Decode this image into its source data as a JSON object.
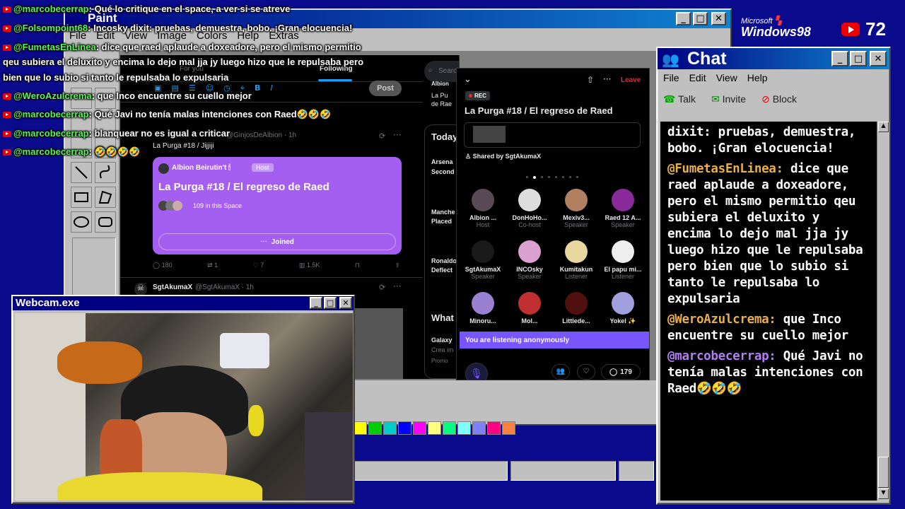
{
  "overlay_chat": [
    {
      "user": "@marcobecerrap",
      "text": ": Qué lo critique en el space, a ver si se atreve"
    },
    {
      "user": "@Folsompoint68",
      "text": ": Incosky dixit: pruebas, demuestra, bobo. ¡Gran elocuencia!"
    },
    {
      "user": "@FumetasEnLinea",
      "text": ": dice que raed aplaude a doxeadore, pero el mismo permitio"
    },
    {
      "user": "",
      "text": "qeu subiera el deluxito y encima lo dejo mal jja jy luego hizo que le repulsaba pero"
    },
    {
      "user": "",
      "text": "bien que lo subio si tanto le repulsaba lo expulsaria"
    },
    {
      "user": "@WeroAzulcrema",
      "text": ": que Inco encuentre su cuello mejor"
    },
    {
      "user": "@marcobecerrap",
      "text": ": Qué Javi no tenía malas intenciones con Raed🤣🤣🤣"
    },
    {
      "user": "@marcobecerrap",
      "text": ": blanquear no es igual a criticar"
    },
    {
      "user": "@marcobecerrap",
      "text": ": 🤣🤣🤣🤣"
    }
  ],
  "branding": {
    "microsoft": "Microsoft",
    "windows": "Windows98",
    "viewer_count": "72"
  },
  "paint": {
    "title": "Paint",
    "menu": [
      "File",
      "Edit",
      "View",
      "Image",
      "Colors",
      "Help",
      "Extras"
    ],
    "palette": [
      "#ffff00",
      "#00cc00",
      "#00cccc",
      "#0000ff",
      "#ff00ff",
      "#ffff80",
      "#00ff80",
      "#80ffff",
      "#8080ff",
      "#ff0080",
      "#ff8040"
    ]
  },
  "x_page": {
    "tabs": [
      "For you",
      "Following"
    ],
    "post_button": "Post",
    "tweet1": {
      "meta": "@GinjosDeAlbion · 1h",
      "text": "La Purga #18 / Jijjiji"
    },
    "space_card": {
      "host": "Albion Beirutin't 🕯",
      "host_badge": "Host",
      "title": "La Purga #18 / El regreso de Raed",
      "listeners": "109 in this Space",
      "joined": "Joined"
    },
    "tweet_stats": {
      "replies": "180",
      "retweets": "1",
      "likes": "7",
      "views": "1.5K"
    },
    "tweet2": {
      "name": "SgtAkumaX",
      "handle": "@SgtAkumaX · 1h"
    },
    "right": {
      "search": "Search",
      "today": "Today",
      "what": "What",
      "arsena": "Arsena",
      "second": "Second",
      "manche": "Manche",
      "placed": "Placed",
      "ronaldo": "Ronaldo",
      "deflect": "Deflect",
      "galaxy": "Galaxy",
      "crea": "Crea im",
      "promo": "Promo",
      "albion_short": "Albion"
    }
  },
  "space_panel": {
    "leave": "Leave",
    "rec": "REC",
    "title": "La Purga #18 / El regreso de Raed",
    "shared_by": "Shared by SgtAkumaX",
    "speakers": [
      {
        "name": "Albion ...",
        "role": "Host",
        "color": "#5a4a55"
      },
      {
        "name": "DonHoHo...",
        "role": "Co-host",
        "color": "#dddddd"
      },
      {
        "name": "Mexiv3...",
        "role": "Speaker",
        "color": "#b08060"
      },
      {
        "name": "Raed 12 A...",
        "role": "Speaker",
        "color": "#8a2a9a"
      },
      {
        "name": "SgtAkumaX",
        "role": "Speaker",
        "color": "#1a1a1a"
      },
      {
        "name": "INCOsky",
        "role": "Speaker",
        "color": "#d9a0d0"
      },
      {
        "name": "Kumitakun",
        "role": "Listener",
        "color": "#e8d8a0"
      },
      {
        "name": "El papu mi...",
        "role": "Listener",
        "color": "#eeeeee"
      },
      {
        "name": "Minoru...",
        "role": "",
        "color": "#9a80d0"
      },
      {
        "name": "Mol...",
        "role": "",
        "color": "#c03030"
      },
      {
        "name": "Littlede...",
        "role": "",
        "color": "#501010"
      },
      {
        "name": "Yokel ✨",
        "role": "",
        "color": "#a0a0e0"
      }
    ],
    "listening_bar": "You are listening anonymously",
    "comment_count": "179"
  },
  "chat_window": {
    "title": "Chat",
    "menu": [
      "File",
      "Edit",
      "View",
      "Help"
    ],
    "toolbar": [
      "Talk",
      "Invite",
      "Block"
    ],
    "messages": [
      {
        "user": "",
        "text": "dixit: pruebas, demuestra, bobo. ¡Gran elocuencia!"
      },
      {
        "user": "@FumetasEnLinea:",
        "text": " dice que raed aplaude a doxeadore, pero el mismo permitio qeu subiera el deluxito y encima lo dejo mal jja jy luego hizo que le repulsaba pero bien que lo subio si tanto le repulsaba lo expulsaria"
      },
      {
        "user": "@WeroAzulcrema:",
        "text": " que Inco encuentre su cuello mejor"
      },
      {
        "user": "@marcobecerrap:",
        "text": " Qué Javi no tenía malas intenciones con Raed🤣🤣🤣"
      }
    ]
  },
  "webcam": {
    "title": "Webcam.exe"
  }
}
